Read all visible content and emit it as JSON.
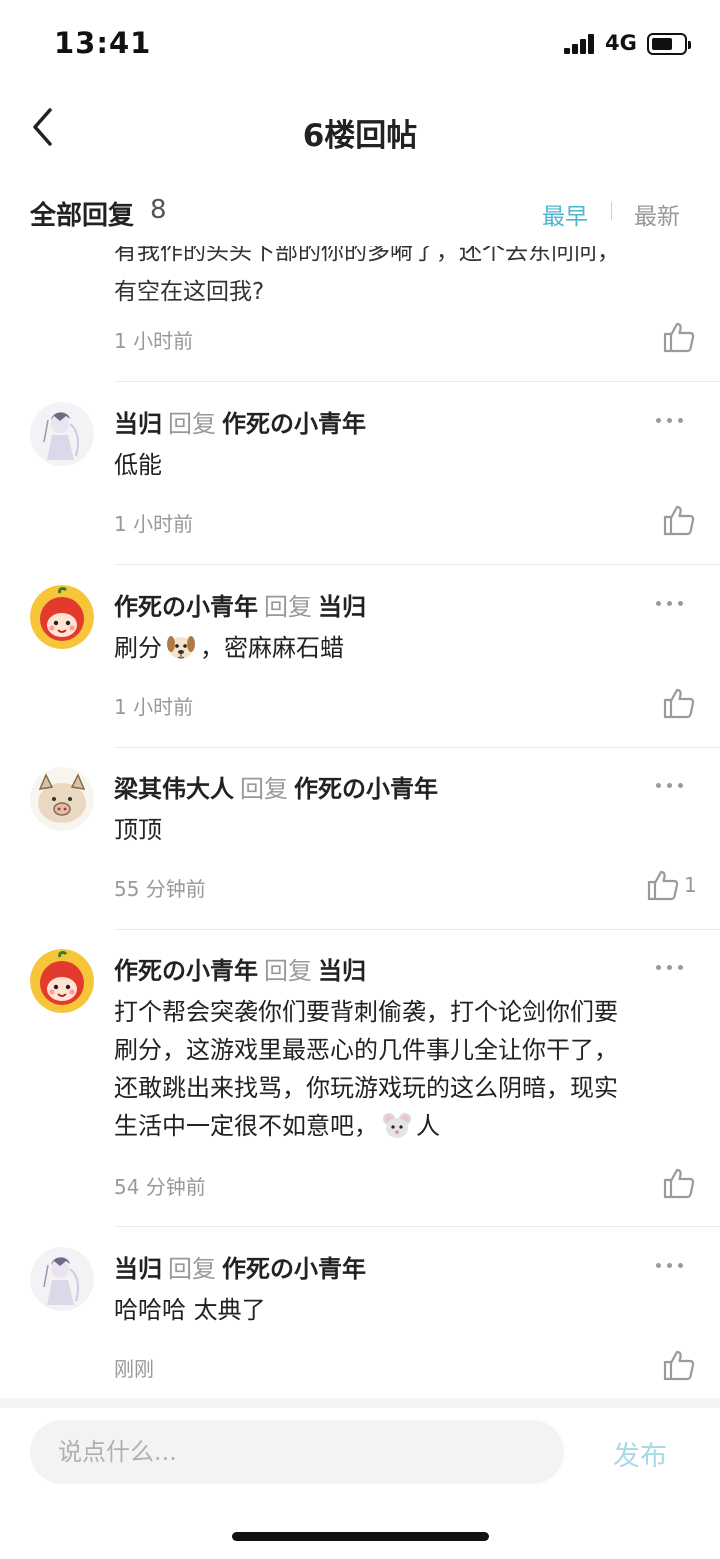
{
  "status": {
    "time": "13:41",
    "network": "4G"
  },
  "nav": {
    "title": "6楼回帖"
  },
  "replies": {
    "title": "全部回复",
    "count": "8",
    "sort_earliest": "最早",
    "sort_latest": "最新"
  },
  "partial": {
    "text_clipped": "有我作的头头下部的你的多嗬了，还个去东问问，",
    "text": "有空在这回我?",
    "time": "1 小时前"
  },
  "comments": [
    {
      "author": "当归",
      "reply_word": "回复",
      "target": "作死の小青年",
      "body": "低能",
      "time": "1 小时前",
      "likes": ""
    },
    {
      "author": "作死の小青年",
      "reply_word": "回复",
      "target": "当归",
      "body_before": "刷分",
      "body_after": "，密麻麻石蜡",
      "emoji": "dog-emoji",
      "time": "1 小时前",
      "likes": ""
    },
    {
      "author": "梁其伟大人",
      "reply_word": "回复",
      "target": "作死の小青年",
      "body": "顶顶",
      "time": "55 分钟前",
      "likes": "1"
    },
    {
      "author": "作死の小青年",
      "reply_word": "回复",
      "target": "当归",
      "body_lines": [
        "打个帮会突袭你们要背刺偷袭，打个论剑你们要",
        "刷分，这游戏里最恶心的几件事儿全让你干了，",
        "还敢跳出来找骂，你玩游戏玩的这么阴暗，现实"
      ],
      "body_last_before": "生活中一定很不如意吧，",
      "body_last_after": "人",
      "emoji": "mouse-emoji",
      "time": "54 分钟前",
      "likes": ""
    },
    {
      "author": "当归",
      "reply_word": "回复",
      "target": "作死の小青年",
      "body": "哈哈哈 太典了",
      "time": "刚刚",
      "likes": ""
    }
  ],
  "input": {
    "placeholder": "说点什么...",
    "value": "",
    "publish_label": "发布"
  },
  "colors": {
    "accent": "#4fb5d2",
    "publish_disabled": "#a9d9e8",
    "muted": "#999999"
  }
}
